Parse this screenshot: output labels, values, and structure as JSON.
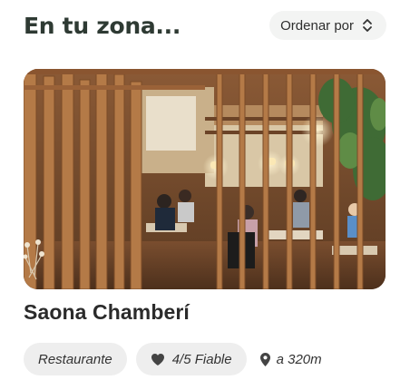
{
  "section": {
    "title": "En tu zona...",
    "sort_label": "Ordenar por",
    "sort_icon": "chevron-up-down-icon"
  },
  "venue": {
    "photo_alt": "Saona Chamberí",
    "name": "Saona Chamberí",
    "category": "Restaurante",
    "rating_label": "4/5 Fiable",
    "rating_icon": "heart-icon",
    "distance_label": "a 320m",
    "distance_icon": "location-pin-icon"
  },
  "colors": {
    "title": "#2e3a33",
    "chip_background": "#eeeeee",
    "sort_background": "#f3f4f3"
  }
}
